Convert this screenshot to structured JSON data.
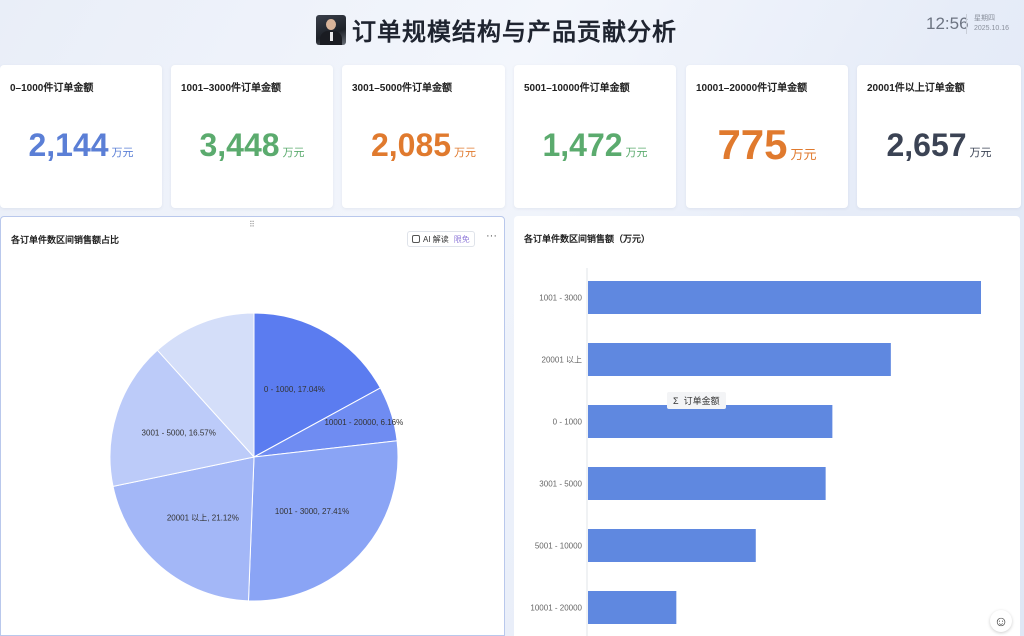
{
  "header": {
    "title": "订单规模结构与产品贡献分析",
    "time": "12:56",
    "weekday": "星期四",
    "date": "2025.10.16"
  },
  "kpis": [
    {
      "label": "0–1000件订单金额",
      "value": "2,144",
      "unit": "万元",
      "color": "#5b7fd6"
    },
    {
      "label": "1001–3000件订单金额",
      "value": "3,448",
      "unit": "万元",
      "color": "#5bab6e"
    },
    {
      "label": "3001–5000件订单金额",
      "value": "2,085",
      "unit": "万元",
      "color": "#e07a2e"
    },
    {
      "label": "5001–10000件订单金额",
      "value": "1,472",
      "unit": "万元",
      "color": "#5bab6e"
    },
    {
      "label": "10001–20000件订单金额",
      "value": "775",
      "unit": "万元",
      "color": "#e07a2e"
    },
    {
      "label": "20001件以上订单金额",
      "value": "2,657",
      "unit": "万元",
      "color": "#3b4354"
    }
  ],
  "left_panel": {
    "title": "各订单件数区间销售额占比",
    "ai_label": "AI 解读",
    "ai_badge": "限免",
    "more": "···"
  },
  "right_panel": {
    "title": "各订单件数区间销售额（万元）",
    "tooltip": "订单金额",
    "tooltip_icon": "Σ"
  },
  "chart_data": [
    {
      "type": "pie",
      "title": "各订单件数区间销售额占比",
      "slices": [
        {
          "label": "0 - 1000",
          "percent": 17.04,
          "display": "0 - 1000, 17.04%",
          "color": "#5b7cf0"
        },
        {
          "label": "10001 - 20000",
          "percent": 6.16,
          "display": "10001 - 20000, 6.16%",
          "color": "#6f8cf2"
        },
        {
          "label": "1001 - 3000",
          "percent": 27.41,
          "display": "1001 - 3000, 27.41%",
          "color": "#8aa4f5"
        },
        {
          "label": "20001 以上",
          "percent": 21.12,
          "display": "20001 以上, 21.12%",
          "color": "#a3b7f7"
        },
        {
          "label": "3001 - 5000",
          "percent": 16.57,
          "display": "3001 - 5000, 16.57%",
          "color": "#bccbf9"
        },
        {
          "label": "5001 - 10000",
          "percent": 11.7,
          "display": "",
          "color": "#d4def9"
        }
      ]
    },
    {
      "type": "bar",
      "orientation": "horizontal",
      "title": "各订单件数区间销售额（万元）",
      "categories": [
        "1001 - 3000",
        "20001 以上",
        "0 - 1000",
        "3001 - 5000",
        "5001 - 10000",
        "10001 - 20000"
      ],
      "values": [
        3448,
        2657,
        2144,
        2085,
        1472,
        775
      ],
      "color": "#5f88e0"
    }
  ]
}
